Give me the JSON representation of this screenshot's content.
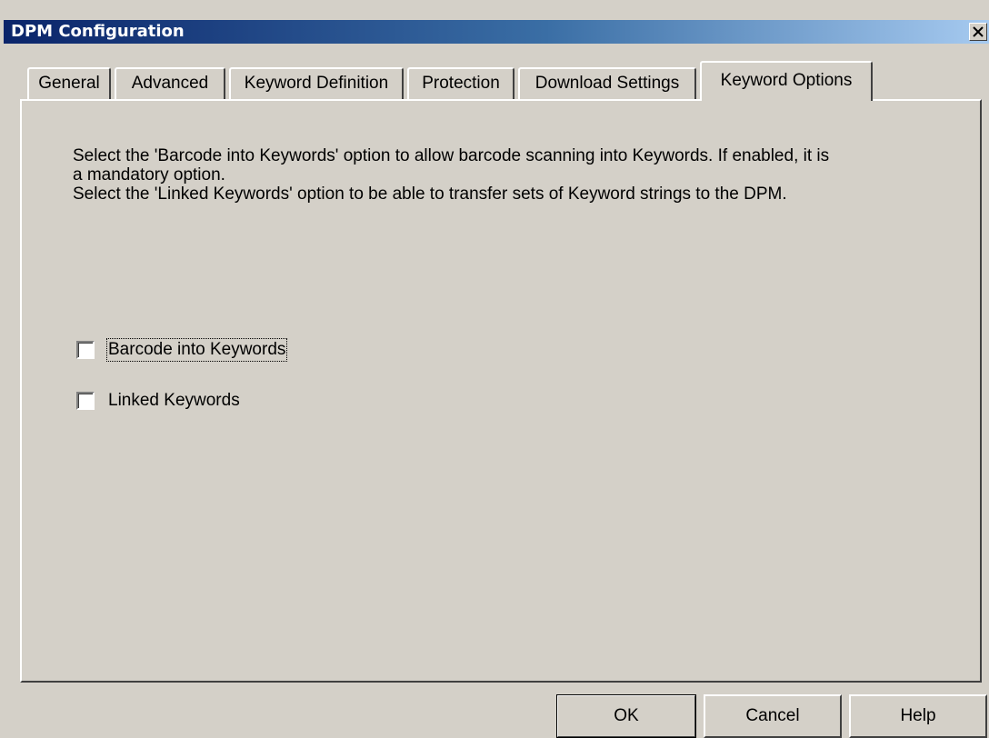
{
  "window": {
    "title": "DPM Configuration",
    "close_label": "×"
  },
  "tabs": [
    {
      "label": "General",
      "active": false
    },
    {
      "label": "Advanced",
      "active": false
    },
    {
      "label": "Keyword Definition",
      "active": false
    },
    {
      "label": "Protection",
      "active": false
    },
    {
      "label": "Download Settings",
      "active": false
    },
    {
      "label": "Keyword Options",
      "active": true
    }
  ],
  "description": {
    "line1": "Select the 'Barcode into Keywords' option to allow barcode scanning into Keywords. If enabled, it is",
    "line2": "a mandatory option.",
    "line3": "Select the 'Linked Keywords' option to be able to transfer sets of Keyword strings to the DPM."
  },
  "options": {
    "barcode_into_keywords": {
      "label": "Barcode into Keywords",
      "checked": false
    },
    "linked_keywords": {
      "label": "Linked Keywords",
      "checked": false
    }
  },
  "buttons": {
    "ok": "OK",
    "cancel": "Cancel",
    "help": "Help"
  },
  "colors": {
    "face": "#d4d0c8",
    "title_start": "#0a246a",
    "title_end": "#a6caf0"
  }
}
